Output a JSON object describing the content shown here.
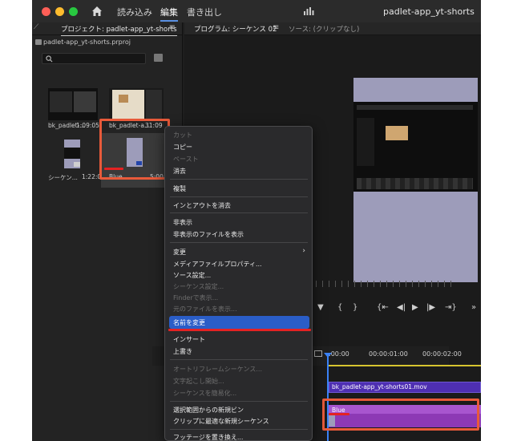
{
  "titlebar": {
    "tabs": [
      "読み込み",
      "編集",
      "書き出し"
    ],
    "active_tab": "編集",
    "document_title": "padlet-app_yt-shorts"
  },
  "project_panel": {
    "tab_label": "プロジェクト: padlet-app_yt-shorts",
    "file_name": "padlet-app_yt-shorts.prproj",
    "items": [
      {
        "name": "bk_padlet-...",
        "duration": "1:09:05"
      },
      {
        "name": "bk_padlet-a...",
        "duration": "31:09"
      },
      {
        "name": "シーケン...",
        "duration": "1:22:02"
      },
      {
        "name": "Blue",
        "duration": "5:00"
      }
    ]
  },
  "program_panel": {
    "tab_program": "プログラム: シーケンス 02",
    "tab_source": "ソース: (クリップなし)"
  },
  "timeline": {
    "timecodes": [
      ":00:00",
      "00:00:01:00",
      "00:00:02:00"
    ],
    "video_clip": "bk_padlet-app_yt-shorts01.mov",
    "blue_clip": "Blue"
  },
  "context_menu": {
    "items": [
      {
        "label": "カット",
        "enabled": false
      },
      {
        "label": "コピー",
        "enabled": true
      },
      {
        "label": "ペースト",
        "enabled": false
      },
      {
        "label": "消去",
        "enabled": true
      },
      {
        "label": "複製",
        "enabled": true
      },
      {
        "label": "インとアウトを消去",
        "enabled": true
      },
      {
        "label": "非表示",
        "enabled": true
      },
      {
        "label": "非表示のファイルを表示",
        "enabled": true
      },
      {
        "label": "変更",
        "enabled": true
      },
      {
        "label": "メディアファイルプロパティ...",
        "enabled": true
      },
      {
        "label": "ソース設定...",
        "enabled": true
      },
      {
        "label": "シーケンス設定...",
        "enabled": false
      },
      {
        "label": "Finderで表示...",
        "enabled": false
      },
      {
        "label": "元のファイルを表示...",
        "enabled": false
      },
      {
        "label": "名前を変更",
        "enabled": true,
        "selected": true
      },
      {
        "label": "インサート",
        "enabled": true
      },
      {
        "label": "上書き",
        "enabled": true
      },
      {
        "label": "オートリフレームシーケンス...",
        "enabled": false
      },
      {
        "label": "文字起こし開始...",
        "enabled": false
      },
      {
        "label": "シーケンスを簡易化...",
        "enabled": false
      },
      {
        "label": "選択範囲からの新規ビン",
        "enabled": true
      },
      {
        "label": "クリップに最適な新規シーケンス",
        "enabled": true
      },
      {
        "label": "フッテージを置き換え...",
        "enabled": true
      }
    ]
  },
  "colors": {
    "selection": "#2a5dc7",
    "highlight": "#e85a3a",
    "clip_video": "#4e2fb2",
    "clip_blue": "#8d39b5",
    "playhead": "#3b82f6"
  }
}
